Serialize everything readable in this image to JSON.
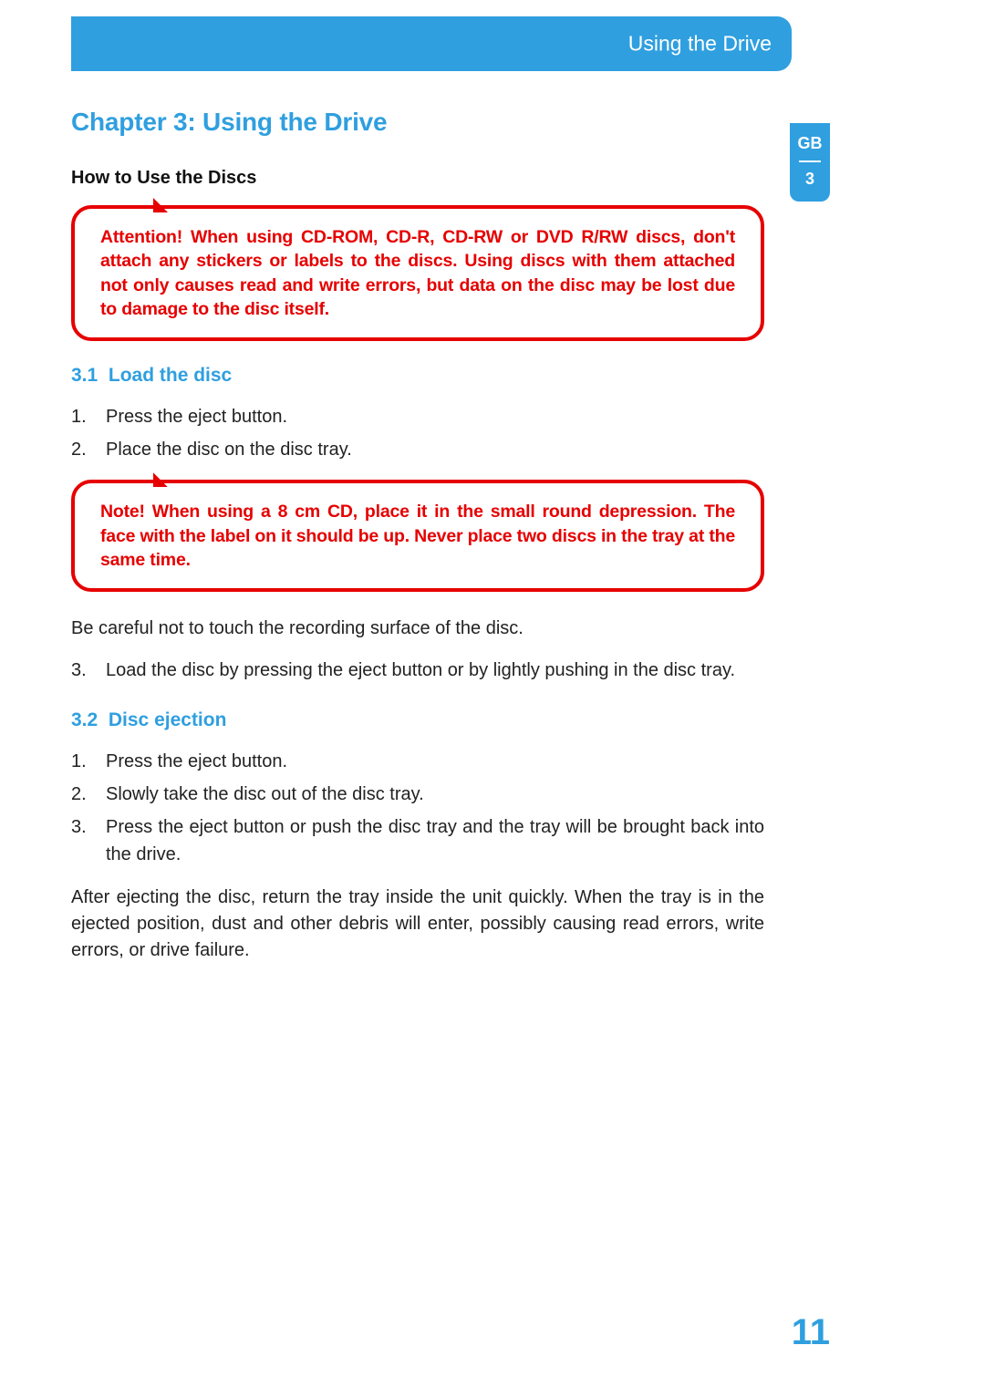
{
  "header": {
    "title": "Using the Drive"
  },
  "sidetab": {
    "lang": "GB",
    "chapter": "3"
  },
  "chapter_heading": "Chapter 3:  Using the Drive",
  "section_heading": "How to Use the Discs",
  "warn1": "Attention! When using CD-ROM, CD-R, CD-RW or DVD R/RW discs, don't attach any stickers or labels to the discs. Using discs with them attached not only causes read and write errors, but data on the disc may be lost due to damage to the disc itself.",
  "sub31": {
    "num": "3.1",
    "title": "Load the disc"
  },
  "steps31a": [
    {
      "n": "1.",
      "t": "Press the eject button."
    },
    {
      "n": "2.",
      "t": "Place the disc on the disc tray."
    }
  ],
  "warn2": "Note! When using a 8 cm CD, place it in the small round depression. The face with the label on it should be up. Never place two discs in the tray at the same time.",
  "para_after_warn2": "Be careful not to touch the recording surface of the disc.",
  "steps31b": [
    {
      "n": "3.",
      "t": "Load the disc by pressing the eject button or by lightly pushing in the disc tray."
    }
  ],
  "sub32": {
    "num": "3.2",
    "title": "Disc ejection"
  },
  "steps32": [
    {
      "n": "1.",
      "t": "Press the eject button."
    },
    {
      "n": "2.",
      "t": "Slowly take the disc out of the disc tray."
    },
    {
      "n": "3.",
      "t": "Press the eject button or push the disc tray and the tray will be brought back into the drive."
    }
  ],
  "para_after_32": "After ejecting the disc, return the tray inside the unit quickly. When the tray is in the ejected position, dust and other debris will enter, possibly causing read errors, write errors, or drive failure.",
  "page_number": "11"
}
